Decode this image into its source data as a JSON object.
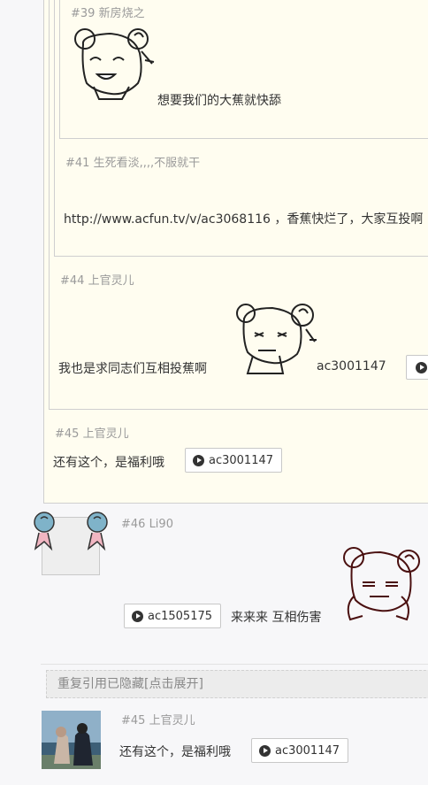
{
  "q39": {
    "header": "#39 新房烧之",
    "text": "想要我们的大蕉就快舔"
  },
  "q41": {
    "header": "#41 生死看淡,,,,不服就干",
    "text": "http://www.acfun.tv/v/ac3068116 ，香蕉快烂了，大家互投啊"
  },
  "q44": {
    "header": "#44 上官灵儿",
    "text": "我也是求同志们互相投蕉啊",
    "ac": "ac3001147"
  },
  "q45": {
    "header": "#45 上官灵儿",
    "text": "还有这个，是福利哦",
    "ac": "ac3001147"
  },
  "post46": {
    "header": "#46 Li90",
    "ac": "ac1505175",
    "text": "来来来  互相伤害"
  },
  "hidden_notice": "重复引用已隐藏[点击展开]",
  "post45": {
    "header": "#45 上官灵儿",
    "text": "还有这个，是福利哦",
    "ac": "ac3001147"
  }
}
